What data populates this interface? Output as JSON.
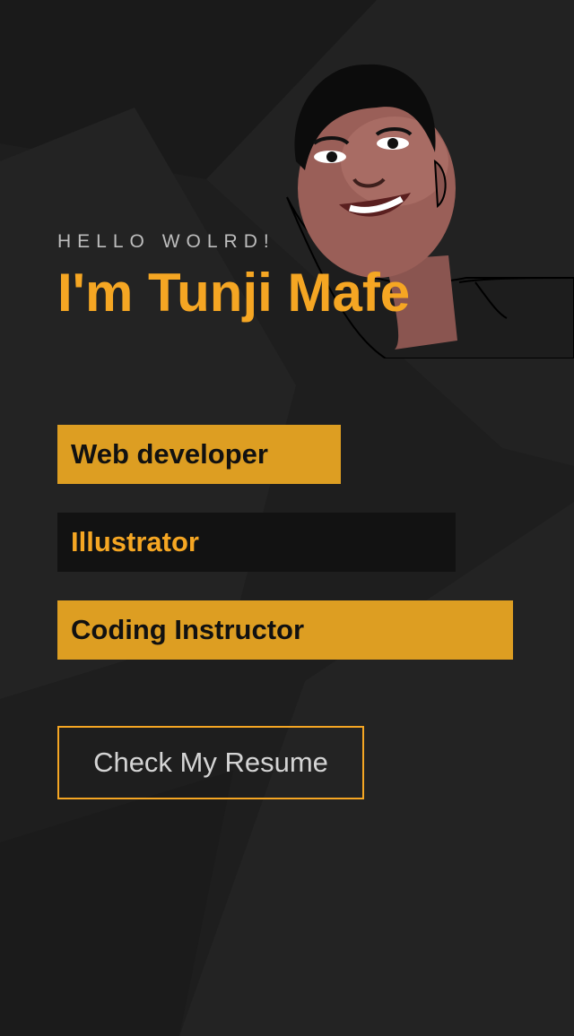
{
  "hero": {
    "greeting": "HELLO WOLRD!",
    "name": "I'm Tunji Mafe"
  },
  "roles": [
    {
      "label": "Web developer",
      "style": "gold"
    },
    {
      "label": "Illustrator",
      "style": "dark"
    },
    {
      "label": "Coding Instructor",
      "style": "gold"
    }
  ],
  "cta": {
    "label": "Check My Resume"
  },
  "colors": {
    "background": "#1e1e1e",
    "accent": "#f5a623",
    "role_gold": "#dd9e22",
    "role_dark": "#121212"
  }
}
